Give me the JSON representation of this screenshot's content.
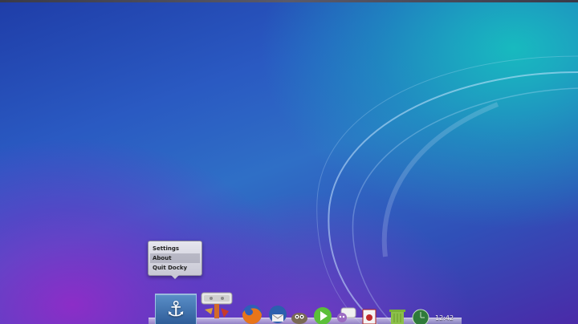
{
  "context_menu": {
    "items": [
      {
        "label": "Settings"
      },
      {
        "label": "About"
      },
      {
        "label": "Quit Docky"
      }
    ]
  },
  "dock": {
    "items": [
      {
        "name": "docky",
        "icon": "anchor-icon"
      },
      {
        "name": "file-manager",
        "icon": "toolbox-icon"
      },
      {
        "name": "firefox",
        "icon": "firefox-icon"
      },
      {
        "name": "thunderbird",
        "icon": "thunderbird-icon"
      },
      {
        "name": "gimp",
        "icon": "gimp-icon"
      },
      {
        "name": "media-player",
        "icon": "play-icon"
      },
      {
        "name": "pidgin",
        "icon": "chat-icon"
      },
      {
        "name": "document-viewer",
        "icon": "document-icon"
      },
      {
        "name": "trash",
        "icon": "trash-icon"
      },
      {
        "name": "clock-applet",
        "icon": "clock-icon"
      }
    ],
    "anchor_glyph": "⚓",
    "clock_text": "12:42"
  },
  "colors": {
    "desktop_base": "#2a5ac2",
    "teal_glow": "#14c8be",
    "purple_glow": "#9628c8",
    "docky_tile": "#3a6fb0"
  }
}
